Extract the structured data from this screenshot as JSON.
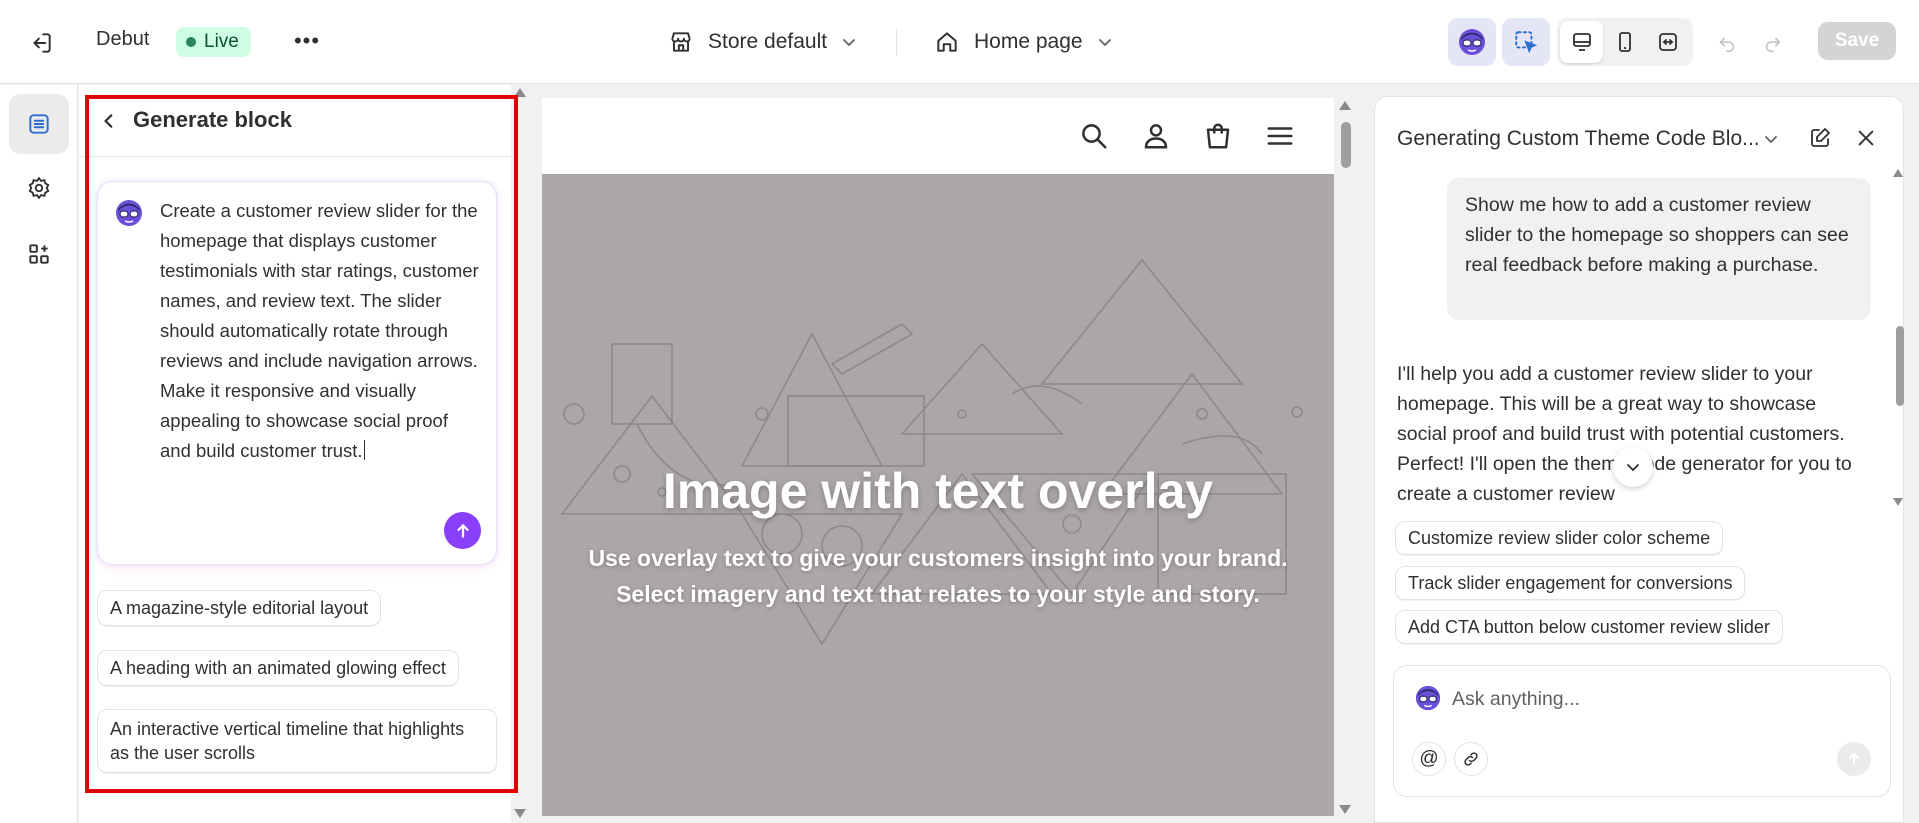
{
  "topbar": {
    "theme_name": "Debut",
    "live_badge": "Live",
    "more_label": "•••",
    "store_selector": "Store default",
    "page_selector": "Home page",
    "save_label": "Save"
  },
  "left_panel": {
    "title": "Generate block",
    "prompt_text": "Create a customer review slider for the homepage that displays customer testimonials with star ratings, customer names, and review text. The slider should automatically rotate through reviews and include navigation arrows. Make it responsive and visually appealing to showcase social proof and build customer trust.",
    "suggestions": [
      "A magazine-style editorial layout",
      "A heading with an animated glowing effect",
      "An interactive vertical timeline that highlights as the user scrolls"
    ]
  },
  "preview": {
    "hero_title": "Image with text overlay",
    "hero_subtitle_line1": "Use overlay text to give your customers insight into your brand.",
    "hero_subtitle_line2": "Select imagery and text that relates to your style and story."
  },
  "right_panel": {
    "title": "Generating Custom Theme Code Blo...",
    "user_message": "Show me how to add a customer review slider to the homepage so shoppers can see real feedback before making a purchase.",
    "ai_message": "I'll help you add a customer review slider to your homepage. This will be a great way to showcase social proof and build trust with potential customers. Perfect! I'll open the theme code generator for you to create a customer review",
    "suggestions": [
      "Customize review slider color scheme",
      "Track slider engagement for conversions",
      "Add CTA button below customer review slider"
    ],
    "ask_placeholder": "Ask anything...",
    "mention_label": "@"
  },
  "colors": {
    "accent_purple": "#8a3ffc",
    "live_green": "#29845a",
    "highlight_red": "#e00000",
    "hero_bg": "#ada6a6"
  },
  "icons": [
    "exit-icon",
    "store-icon",
    "home-icon",
    "chevron-down-icon",
    "ai-assistant-icon",
    "inspect-icon",
    "desktop-icon",
    "mobile-icon",
    "fullwidth-icon",
    "undo-icon",
    "redo-icon",
    "sections-icon",
    "settings-icon",
    "apps-icon",
    "back-icon",
    "send-icon",
    "search-icon",
    "account-icon",
    "bag-icon",
    "menu-icon",
    "edit-icon",
    "close-icon",
    "link-icon"
  ]
}
